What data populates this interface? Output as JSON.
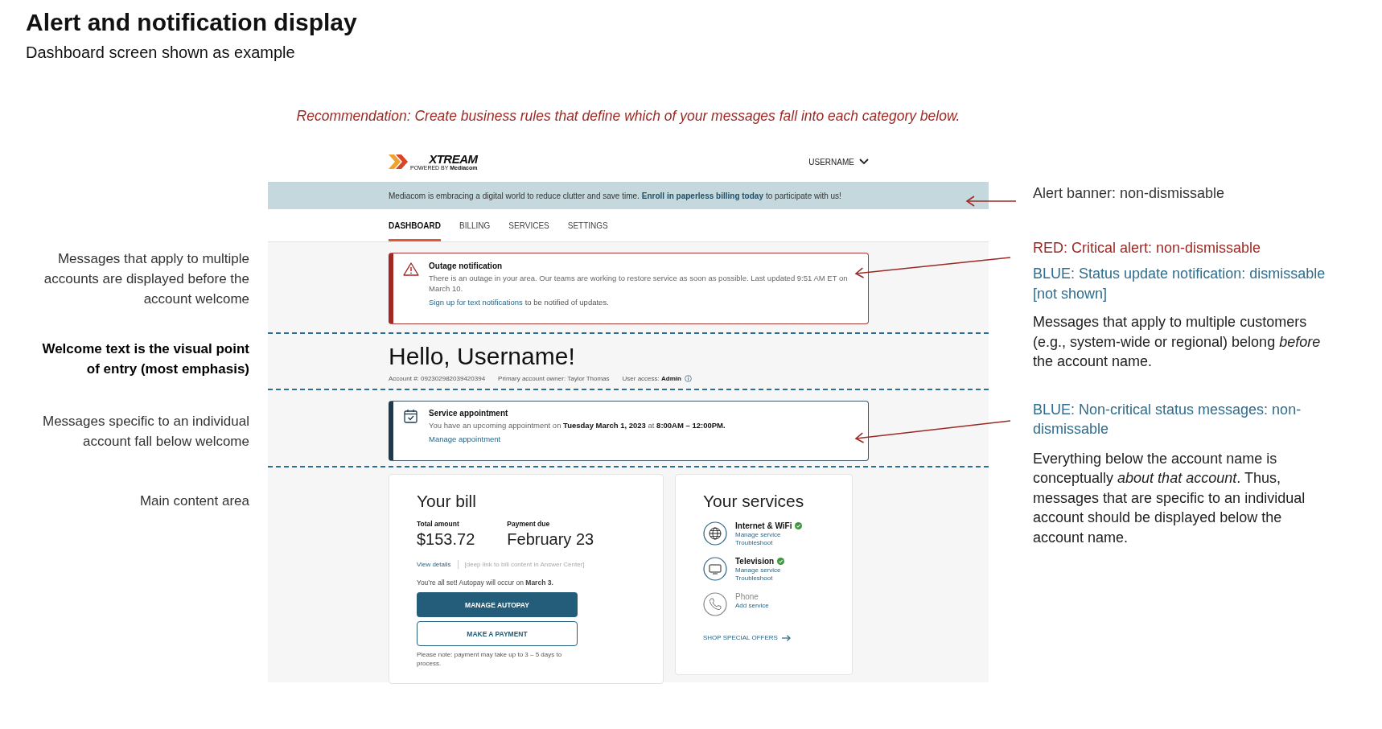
{
  "title": "Alert and notification display",
  "subtitle": "Dashboard screen shown as example",
  "recommendation": "Recommendation: Create business rules that define which of your messages fall into each category below.",
  "left_notes": [
    {
      "text": "Messages that apply to multiple accounts are displayed before the account welcome",
      "bold": false
    },
    {
      "text": "Welcome text is the visual point of entry (most emphasis)",
      "bold": true
    },
    {
      "text": "Messages specific to an individual account fall below welcome",
      "bold": false
    },
    {
      "text": "Main content area",
      "bold": false
    }
  ],
  "right_notes": [
    {
      "text": "Alert banner: non-dismissable",
      "color": "#333333"
    },
    {
      "text": "RED: Critical alert: non-dismissable",
      "color": "#9b2a25"
    },
    {
      "text": "BLUE: Status update notification: dismissable [not shown]",
      "color": "#2f6d8e"
    },
    {
      "text": "Messages that apply to multiple customers (e.g., system-wide or regional) belong *before* the account name.",
      "color": "#222222"
    },
    {
      "text": "BLUE: Non-critical status messages: non-dismissable",
      "color": "#2f6d8e"
    },
    {
      "text": "Everything below the account name is conceptually *about that account*. Thus, messages that are specific to an individual account should be displayed below the account name.",
      "color": "#222222"
    }
  ],
  "mockup": {
    "logo": {
      "wordmark": "XTREAM",
      "tagline": "POWERED BY **Mediacom**"
    },
    "user_menu": "USERNAME",
    "banner": {
      "before": "Mediacom is embracing a digital world to reduce clutter and save time.",
      "link": "Enroll in paperless billing today",
      "after": "to participate with us!"
    },
    "tabs": [
      {
        "label": "DASHBOARD",
        "selected": true
      },
      {
        "label": "BILLING",
        "selected": false
      },
      {
        "label": "SERVICES",
        "selected": false
      },
      {
        "label": "SETTINGS",
        "selected": false
      }
    ],
    "outage": {
      "title": "Outage notification",
      "body": "There is an outage in your area. Our teams are working to restore service as soon as possible. Last updated 9:51 AM ET on March 10.",
      "link": "Sign up for text notifications",
      "link_suffix": "to be notified of updates."
    },
    "greeting": "Hello, Username!",
    "account": {
      "number": "Account #: 092302982039420394",
      "owner": "Primary account owner: Taylor Thomas",
      "access": "User access: **Admin**"
    },
    "appointment": {
      "title": "Service appointment",
      "body": "You have an upcoming appointment on **Tuesday March 1, 2023** at **8:00AM – 12:00PM.**",
      "link": "Manage appointment"
    },
    "bill": {
      "heading": "Your bill",
      "total_label": "Total amount",
      "total": "$153.72",
      "due_label": "Payment due",
      "due": "February 23",
      "details_link": "View details",
      "details_note": "[deep link to bill content in Answer Center]",
      "autopay": "You’re all set! Autopay will occur on **March 3.**",
      "primary_button": "MANAGE AUTOPAY",
      "secondary_button": "MAKE A PAYMENT",
      "note": "Please note: payment may take up to 3 – 5 days to process."
    },
    "services": {
      "heading": "Your services",
      "items": [
        {
          "kind": "internet",
          "name": "Internet & WiFi",
          "active": true,
          "links": [
            "Manage service",
            "Troubleshoot"
          ]
        },
        {
          "kind": "tv",
          "name": "Television",
          "active": true,
          "links": [
            "Manage service",
            "Troubleshoot"
          ]
        },
        {
          "kind": "phone",
          "name": "Phone",
          "active": false,
          "links": [
            "Add service"
          ]
        }
      ],
      "offers": "SHOP SPECIAL OFFERS"
    }
  }
}
